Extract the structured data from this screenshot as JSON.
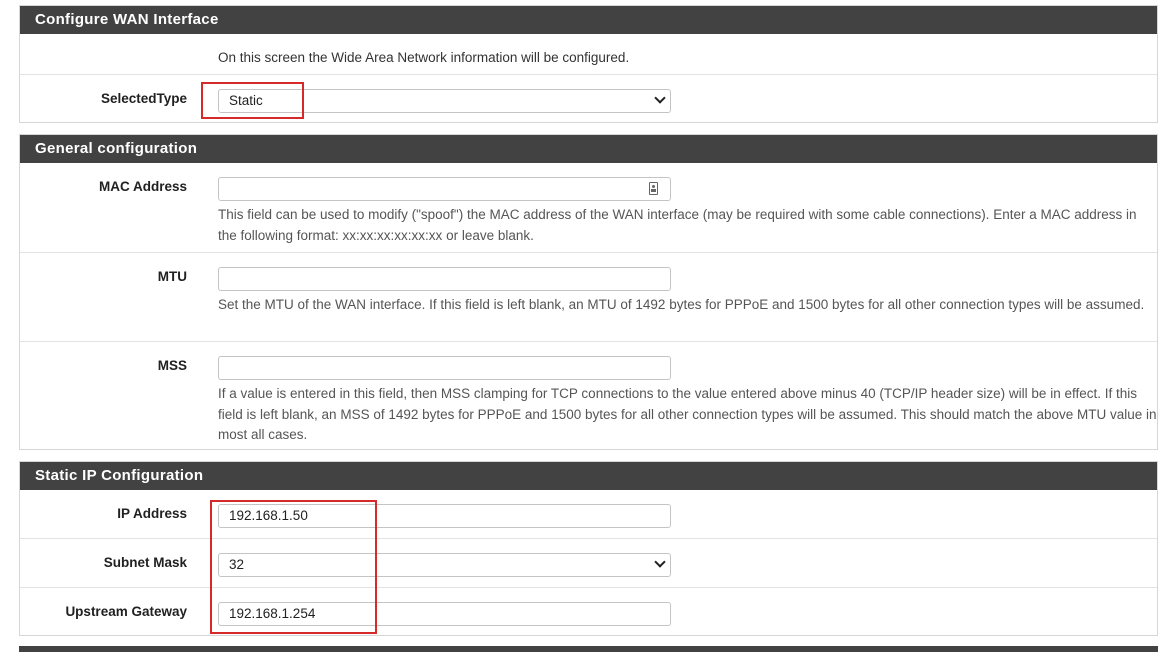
{
  "wan": {
    "title": "Configure WAN Interface",
    "intro": "On this screen the Wide Area Network information will be configured.",
    "selected_type_label": "SelectedType",
    "selected_type_value": "Static"
  },
  "general": {
    "title": "General configuration",
    "mac_label": "MAC Address",
    "mac_value": "",
    "mac_help": "This field can be used to modify (\"spoof\") the MAC address of the WAN interface (may be required with some cable connections). Enter a MAC address in the following format: xx:xx:xx:xx:xx:xx or leave blank.",
    "mtu_label": "MTU",
    "mtu_value": "",
    "mtu_help": "Set the MTU of the WAN interface. If this field is left blank, an MTU of 1492 bytes for PPPoE and 1500 bytes for all other connection types will be assumed.",
    "mss_label": "MSS",
    "mss_value": "",
    "mss_help": "If a value is entered in this field, then MSS clamping for TCP connections to the value entered above minus 40 (TCP/IP header size) will be in effect. If this field is left blank, an MSS of 1492 bytes for PPPoE and 1500 bytes for all other connection types will be assumed. This should match the above MTU value in most all cases."
  },
  "static_ip": {
    "title": "Static IP Configuration",
    "ip_label": "IP Address",
    "ip_value": "192.168.1.50",
    "subnet_label": "Subnet Mask",
    "subnet_value": "32",
    "gateway_label": "Upstream Gateway",
    "gateway_value": "192.168.1.254"
  },
  "icons": {
    "mac_field_icon": "contact-card-icon",
    "select_icon": "chevron-down-icon"
  },
  "colors": {
    "header_bg": "#424242",
    "highlight": "#d62a2a"
  }
}
